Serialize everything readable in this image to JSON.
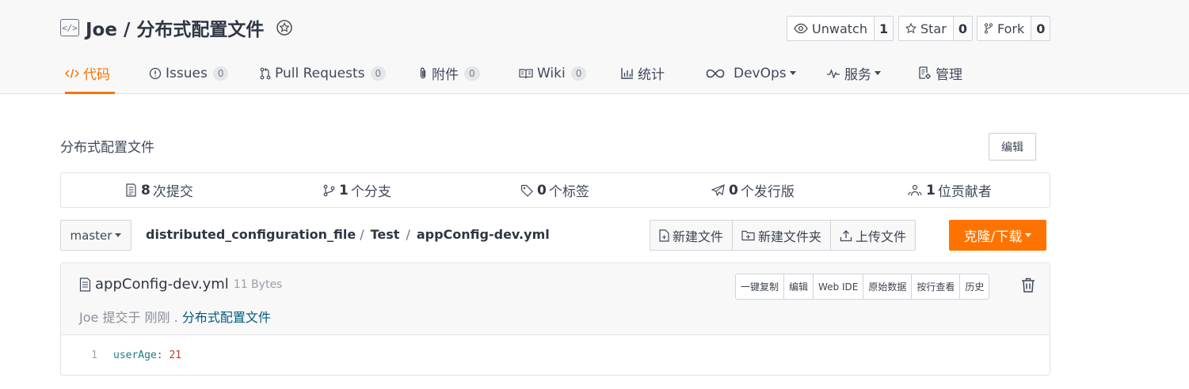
{
  "repo": {
    "owner": "Joe",
    "name": "分布式配置文件",
    "title": "Joe / 分布式配置文件"
  },
  "actions": {
    "watch": {
      "label": "Unwatch",
      "count": "1"
    },
    "star": {
      "label": "Star",
      "count": "0"
    },
    "fork": {
      "label": "Fork",
      "count": "0"
    }
  },
  "tabs": [
    {
      "label": "代码",
      "count": null,
      "icon": "code-icon",
      "active": true
    },
    {
      "label": "Issues",
      "count": "0",
      "icon": "issue-icon"
    },
    {
      "label": "Pull Requests",
      "count": "0",
      "icon": "pull-request-icon"
    },
    {
      "label": "附件",
      "count": "0",
      "icon": "paperclip-icon"
    },
    {
      "label": "Wiki",
      "count": "0",
      "icon": "book-icon"
    },
    {
      "label": "统计",
      "count": null,
      "icon": "bar-chart-icon"
    },
    {
      "label": "DevOps",
      "count": null,
      "icon": "infinity-icon",
      "dropdown": true
    },
    {
      "label": "服务",
      "count": null,
      "icon": "pulse-icon",
      "dropdown": true
    },
    {
      "label": "管理",
      "count": null,
      "icon": "settings-doc-icon"
    }
  ],
  "description": "分布式配置文件",
  "edit_label": "编辑",
  "stats": [
    {
      "num": "8",
      "label": "次提交",
      "icon": "commits-icon"
    },
    {
      "num": "1",
      "label": "个分支",
      "icon": "branch-icon"
    },
    {
      "num": "0",
      "label": "个标签",
      "icon": "tag-icon"
    },
    {
      "num": "0",
      "label": "个发行版",
      "icon": "release-icon"
    },
    {
      "num": "1",
      "label": "位贡献者",
      "icon": "contributors-icon"
    }
  ],
  "branch": "master",
  "path": {
    "repo_dir": "distributed_configuration_file",
    "folder": "Test",
    "file": "appConfig-dev.yml",
    "separator": "/"
  },
  "file_actions": {
    "new_file": "新建文件",
    "new_folder": "新建文件夹",
    "upload": "上传文件"
  },
  "clone_label": "克隆/下载",
  "file": {
    "name": "appConfig-dev.yml",
    "size": "11 Bytes",
    "commit_author": "Joe",
    "commit_text": "提交于 刚刚 .",
    "commit_message": "分布式配置文件",
    "tools": [
      "一键复制",
      "编辑",
      "Web IDE",
      "原始数据",
      "按行查看",
      "历史"
    ]
  },
  "code": {
    "line_number": "1",
    "key": "userAge",
    "colon": ":",
    "value": "21"
  },
  "colors": {
    "accent": "#fe7300",
    "link": "#005980"
  }
}
